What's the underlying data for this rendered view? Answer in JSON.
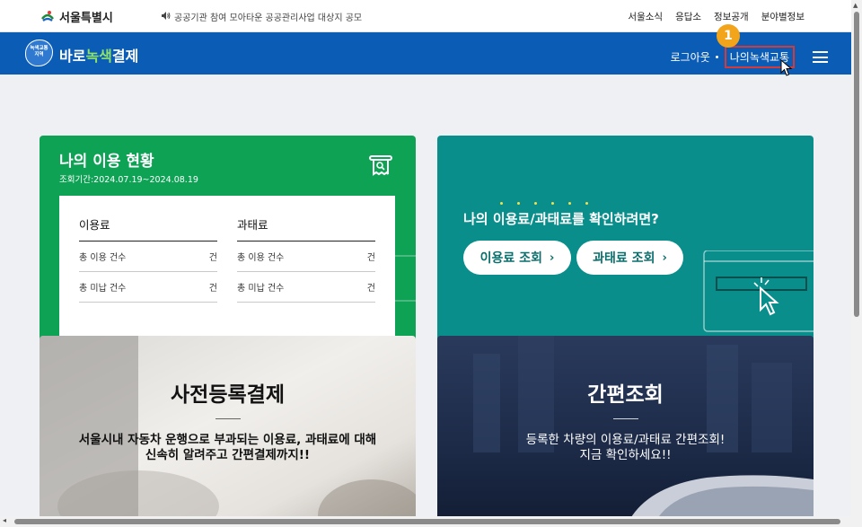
{
  "topbar": {
    "city_name": "서울특별시",
    "notice_text": "공공기관 참여 모아타운 공공관리사업 대상지 공모",
    "links": [
      "서울소식",
      "응답소",
      "정보공개",
      "분야별정보"
    ]
  },
  "header": {
    "badge_lines": [
      "녹색교통",
      "지역"
    ],
    "service_name_part1": "바로",
    "service_name_part2": "녹색",
    "service_name_part3": "결제",
    "logout": "로그아웃",
    "my_green_traffic": "나의녹색교통",
    "step_badge": "1"
  },
  "usage": {
    "title": "나의 이용 현황",
    "period": "조회기간:2024.07.19~2024.08.19",
    "fee": {
      "heading": "이용료",
      "rows": [
        {
          "label": "총 이용 건수",
          "unit": "건"
        },
        {
          "label": "총 미납 건수",
          "unit": "건"
        }
      ]
    },
    "penalty": {
      "heading": "과태료",
      "rows": [
        {
          "label": "총 이용 건수",
          "unit": "건"
        },
        {
          "label": "총 미납 건수",
          "unit": "건"
        }
      ]
    }
  },
  "check": {
    "title": "나의 이용료/과태료를 확인하려면?",
    "fee_button": "이용료 조회",
    "penalty_button": "과태료 조회"
  },
  "prepay": {
    "title": "사전등록결제",
    "desc_line1": "서울시내 자동차 운행으로 부과되는 이용료, 과태료에 대해",
    "desc_line2": "신속히 알려주고 간편결제까지!!"
  },
  "quick": {
    "title": "간편조회",
    "desc_line1": "등록한 차량의 이용료/과태료 간편조회!",
    "desc_line2": "지금 확인하세요!!"
  },
  "colors": {
    "header_blue": "#0b5cb5",
    "usage_green": "#0ea255",
    "check_teal": "#0a8e8c",
    "highlight_red": "#d43a3a",
    "step_orange": "#f2a51a"
  }
}
